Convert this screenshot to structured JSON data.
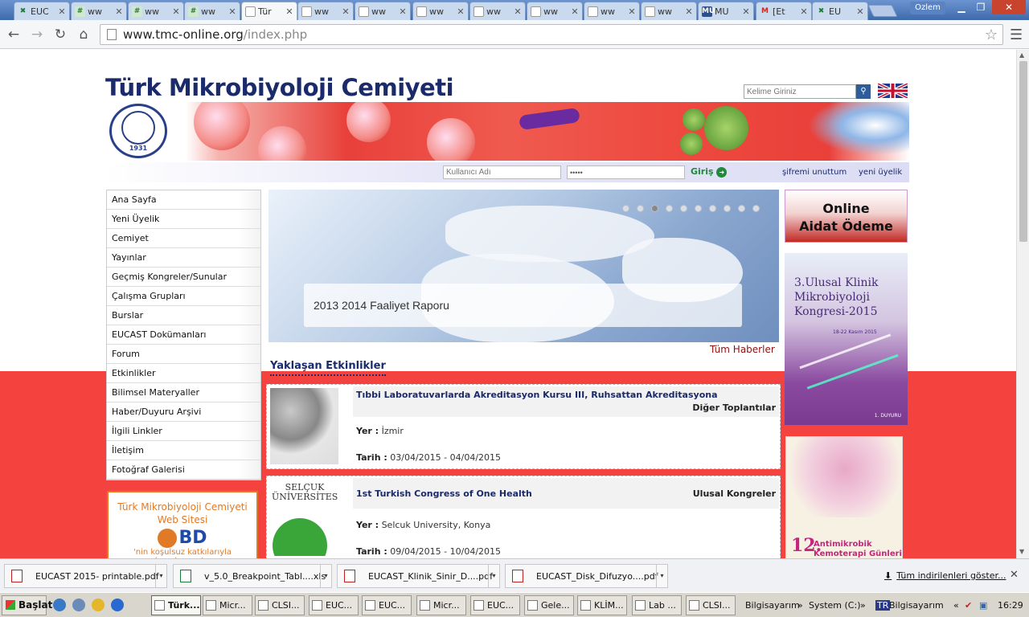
{
  "browser": {
    "tabs": [
      {
        "label": "EUC",
        "icon": "eucast-favicon"
      },
      {
        "label": "ww",
        "icon": "grid-favicon"
      },
      {
        "label": "ww",
        "icon": "grid-favicon"
      },
      {
        "label": "ww",
        "icon": "grid-favicon"
      },
      {
        "label": "Tür",
        "icon": "page-favicon",
        "active": true
      },
      {
        "label": "ww",
        "icon": "page-favicon"
      },
      {
        "label": "ww",
        "icon": "page-favicon"
      },
      {
        "label": "ww",
        "icon": "page-favicon"
      },
      {
        "label": "ww",
        "icon": "page-favicon"
      },
      {
        "label": "ww",
        "icon": "page-favicon"
      },
      {
        "label": "ww",
        "icon": "page-favicon"
      },
      {
        "label": "ww",
        "icon": "page-favicon"
      },
      {
        "label": "MU",
        "icon": "mu-favicon"
      },
      {
        "label": "[Et",
        "icon": "gmail-favicon"
      },
      {
        "label": "EU",
        "icon": "eucast-favicon"
      }
    ],
    "user": "Ozlem",
    "url_host": "www.tmc-online.org",
    "url_path": "/index.php"
  },
  "site": {
    "title": "Türk Mikrobiyoloji Cemiyeti",
    "search_placeholder": "Kelime Giriniz",
    "logo_year": "1931",
    "login": {
      "username_placeholder": "Kullanıcı Adı",
      "password_value": "•••••",
      "button": "Giriş",
      "forgot": "şifremi unuttum",
      "signup": "yeni üyelik"
    },
    "nav": [
      "Ana Sayfa",
      "Yeni Üyelik",
      "Cemiyet",
      "Yayınlar",
      "Geçmiş Kongreler/Sunular",
      "Çalışma Grupları",
      "Burslar",
      "EUCAST Dokümanları",
      "Forum",
      "Etkinlikler",
      "Bilimsel Materyaller",
      "Haber/Duyuru Arşivi",
      "İlgili Linkler",
      "İletişim",
      "Fotoğraf Galerisi"
    ],
    "bd_box": {
      "title": "Türk Mikrobiyoloji Cemiyeti Web Sitesi",
      "logo": "BD",
      "sub": "'nin koşulsuz katkılarıyla hazırlanmıştır"
    },
    "slider": {
      "caption": "2013 2014 Faaliyet Raporu",
      "dots": 10,
      "active_dot": 3
    },
    "all_news": "Tüm Haberler",
    "events_heading": "Yaklaşan Etkinlikler",
    "events": [
      {
        "title": "Tıbbi Laboratuvarlarda Akreditasyon Kursu III, Ruhsattan Akreditasyona",
        "category": "Diğer Toplantılar",
        "place_label": "Yer :",
        "place": "İzmir",
        "date_label": "Tarih :",
        "date": "03/04/2015 - 04/04/2015"
      },
      {
        "title": "1st Turkish Congress of One Health",
        "category": "Ulusal Kongreler",
        "place_label": "Yer :",
        "place": "Selcuk University, Konya",
        "date_label": "Tarih :",
        "date": "09/04/2015 - 10/04/2015",
        "logo_text": "SELÇUK ÜNİVERSİTESİ"
      }
    ],
    "aidat": {
      "line1": "Online",
      "line2": "Aidat Ödeme"
    },
    "congress": {
      "text": "3.Ulusal Klinik Mikrobiyoloji Kongresi-2015",
      "date": "18-22 Kasım 2015",
      "duyuru": "1. DUYURU"
    },
    "antimik": {
      "num": "12.",
      "text": "Antimikrobik Kemoterapi Günleri"
    }
  },
  "downloads": {
    "items": [
      "EUCAST 2015- printable.pdf",
      "v_5.0_Breakpoint_Tabl....xls",
      "EUCAST_Klinik_Sinir_D....pdf",
      "EUCAST_Disk_Difuzyo....pdf"
    ],
    "show_all": "Tüm indirilenleri göster..."
  },
  "taskbar": {
    "start": "Başlat",
    "buttons": [
      "Türk...",
      "Micr...",
      "CLSI...",
      "EUC...",
      "EUC...",
      "Micr...",
      "EUC...",
      "Gele...",
      "KLİM...",
      "Lab ...",
      "CLSI..."
    ],
    "tray": [
      "Bilgisayarım",
      "System (C:)",
      "Bilgisayarım"
    ],
    "clock": "16:29"
  }
}
